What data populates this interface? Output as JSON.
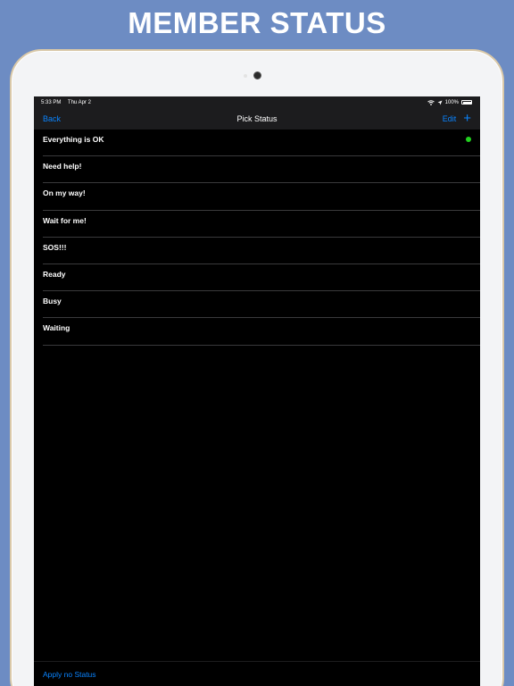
{
  "banner": {
    "title": "MEMBER STATUS"
  },
  "status_bar": {
    "time": "5:33 PM",
    "date": "Thu Apr 2",
    "battery_percent": "100%",
    "battery_level": 1.0
  },
  "nav": {
    "back_label": "Back",
    "title": "Pick Status",
    "edit_label": "Edit",
    "add_symbol": "+"
  },
  "statuses": [
    {
      "label": "Everything is OK",
      "selected": true
    },
    {
      "label": "Need help!",
      "selected": false
    },
    {
      "label": "On my way!",
      "selected": false
    },
    {
      "label": "Wait for me!",
      "selected": false
    },
    {
      "label": "SOS!!!",
      "selected": false
    },
    {
      "label": "Ready",
      "selected": false
    },
    {
      "label": "Busy",
      "selected": false
    },
    {
      "label": "Waiting",
      "selected": false
    }
  ],
  "footer": {
    "apply_none_label": "Apply no Status"
  },
  "colors": {
    "accent": "#0a84ff",
    "selected_indicator": "#22d11f",
    "banner_background": "#6d8cc3"
  },
  "icons": {
    "wifi": "wifi-icon",
    "location": "location-arrow-icon",
    "battery": "battery-icon",
    "selected": "selected-dot-icon",
    "add": "plus-icon"
  }
}
